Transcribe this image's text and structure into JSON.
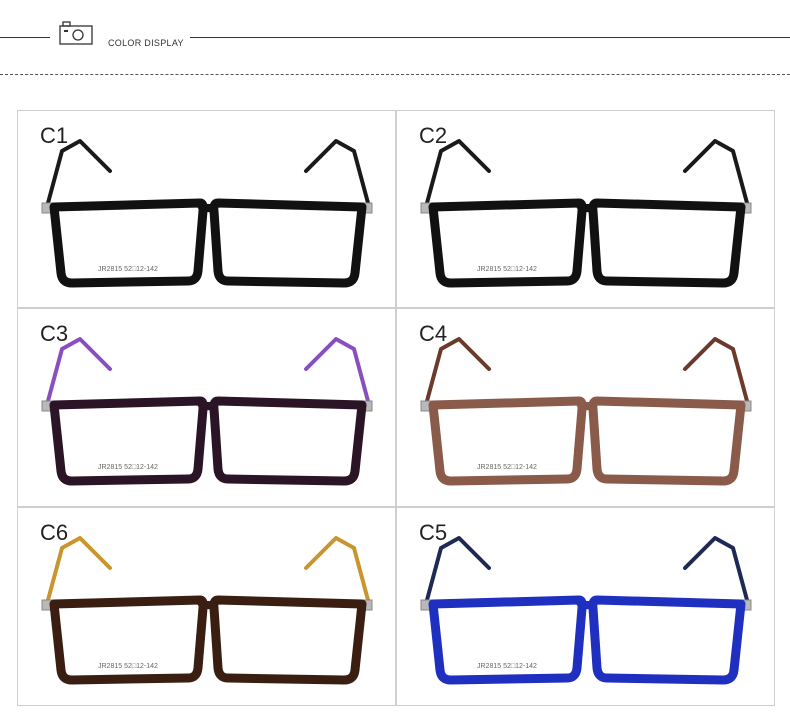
{
  "header": {
    "title": "COLOR DISPLAY",
    "icon": "camera-icon"
  },
  "variants": [
    {
      "label": "C1",
      "frame_color": "#111111",
      "temple_color": "#1a1a1a",
      "frame_text": "JR2815  52□12-142"
    },
    {
      "label": "C2",
      "frame_color": "#111111",
      "temple_color": "#1a1a1a",
      "frame_text": "JR2815  52□12-142"
    },
    {
      "label": "C3",
      "frame_color": "#2a1426",
      "temple_color": "#8a4fbf",
      "frame_text": "JR2815  52□12-142"
    },
    {
      "label": "C4",
      "frame_color": "#8a5a4a",
      "temple_color": "#6b3a2a",
      "frame_text": "JR2815  52□12-142"
    },
    {
      "label": "C6",
      "frame_color": "#3a1e12",
      "temple_color": "#c8952e",
      "frame_text": "JR2815  52□12-142"
    },
    {
      "label": "C5",
      "frame_color": "#1f2fc0",
      "temple_color": "#1e2a55",
      "frame_text": "JR2815  52□12-142"
    }
  ]
}
